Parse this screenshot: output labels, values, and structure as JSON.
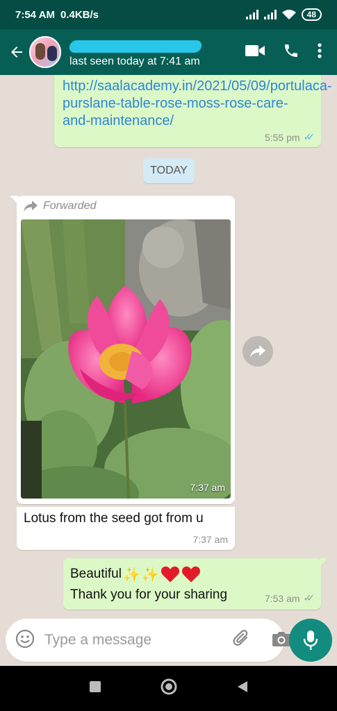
{
  "status_bar": {
    "time": "7:54 AM",
    "network_speed": "0.4KB/s",
    "battery": "48"
  },
  "header": {
    "last_seen": "last seen today at 7:41 am"
  },
  "messages": {
    "link": {
      "text": "http://saalacademy.in/2021/05/09/portulaca-purslane-table-rose-moss-rose-care-and-maintenance/",
      "time": "5:55 pm"
    },
    "date_chip": "TODAY",
    "forwarded_label": "Forwarded",
    "photo_time": "7:37 am",
    "caption": "Lotus from the seed got from u",
    "caption_time": "7:37 am",
    "reply_word": "Beautiful",
    "reply_line2": "Thank you for your sharing",
    "reply_time": "7:53 am"
  },
  "composer": {
    "placeholder": "Type a message"
  },
  "colors": {
    "header": "#075e54",
    "status_bar": "#054d44",
    "chat_bg": "#e5ddd5",
    "outgoing": "#dcf8c6",
    "link": "#2f86d6",
    "read_ticks": "#4fb3f5",
    "mic": "#128c7e"
  },
  "icons": [
    "back-arrow-icon",
    "video-call-icon",
    "phone-icon",
    "more-options-icon",
    "forward-icon",
    "emoji-icon",
    "attach-icon",
    "camera-icon",
    "mic-icon",
    "sparkles-icon",
    "heart-icon"
  ]
}
